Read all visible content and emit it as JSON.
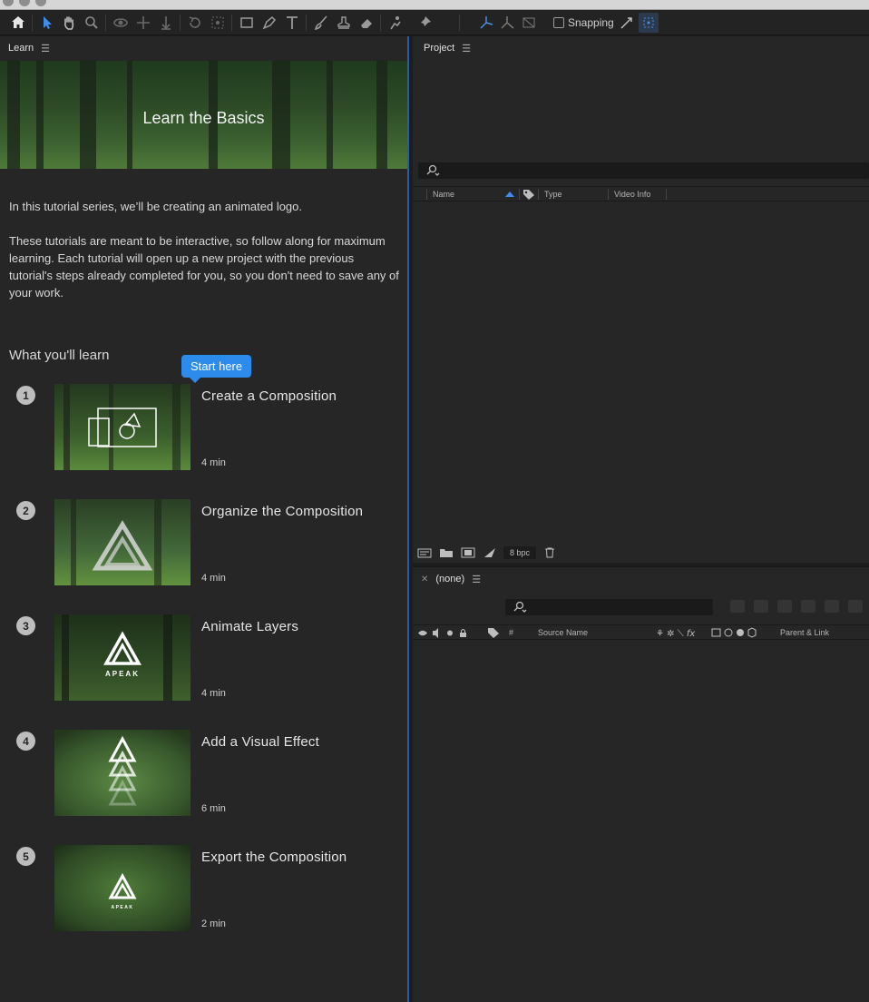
{
  "toolbar": {
    "snapping_label": "Snapping",
    "tools": [
      "home-icon",
      "selection-tool-icon",
      "hand-tool-icon",
      "zoom-tool-icon",
      "orbit-camera-icon",
      "pan-camera-icon",
      "dolly-camera-icon",
      "rotation-tool-icon",
      "anchor-point-tool-icon",
      "rectangle-tool-icon",
      "pen-tool-icon",
      "type-tool-icon",
      "brush-tool-icon",
      "clone-stamp-icon",
      "eraser-icon",
      "roto-brush-icon",
      "puppet-pin-icon"
    ]
  },
  "learn": {
    "panel_title": "Learn",
    "hero_title": "Learn the Basics",
    "intro": [
      "In this tutorial series, we’ll be creating an animated logo.",
      "These tutorials are meant to be interactive, so follow along for maximum learning. Each tutorial will open up a new project with the previous tutorial's steps already completed for you, so you don't need to save any of your work."
    ],
    "section_heading": "What you'll learn",
    "start_tip": "Start here",
    "lessons": [
      {
        "number": "1",
        "title": "Create a Composition",
        "duration": "4 min"
      },
      {
        "number": "2",
        "title": "Organize the Composition",
        "duration": "4 min"
      },
      {
        "number": "3",
        "title": "Animate Layers",
        "duration": "4 min"
      },
      {
        "number": "4",
        "title": "Add a Visual Effect",
        "duration": "6 min"
      },
      {
        "number": "5",
        "title": "Export the Composition",
        "duration": "2 min"
      }
    ],
    "logo_text": "APEAK"
  },
  "project": {
    "panel_title": "Project",
    "columns": [
      "Name",
      "Type",
      "Video Info"
    ],
    "bpc": "8 bpc"
  },
  "timeline": {
    "tab_title": "(none)",
    "columns": [
      "#",
      "Source Name",
      "Parent & Link"
    ]
  }
}
